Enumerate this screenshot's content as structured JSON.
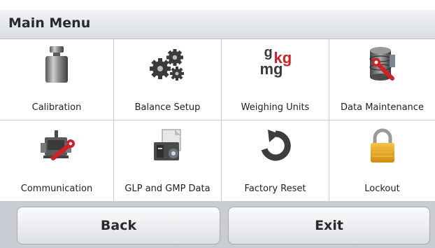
{
  "header": {
    "title": "Main Menu"
  },
  "menu": {
    "items": [
      {
        "label": "Calibration",
        "icon": "calibration-weight-icon"
      },
      {
        "label": "Balance Setup",
        "icon": "gears-icon"
      },
      {
        "label": "Weighing Units",
        "icon": "units-icon",
        "unit_g": "g",
        "unit_kg": "kg",
        "unit_mg": "mg"
      },
      {
        "label": "Data Maintenance",
        "icon": "database-wrench-icon"
      },
      {
        "label": "Communication",
        "icon": "interface-wrench-icon"
      },
      {
        "label": "GLP and GMP Data",
        "icon": "printer-document-icon"
      },
      {
        "label": "Factory Reset",
        "icon": "reset-arrow-icon"
      },
      {
        "label": "Lockout",
        "icon": "padlock-icon"
      }
    ]
  },
  "footer": {
    "back_label": "Back",
    "exit_label": "Exit"
  },
  "colors": {
    "header_bg": "#dfe2e6",
    "footer_bg": "#c9cdd3",
    "accent_red": "#d32027",
    "lock_gold": "#e3a81f"
  }
}
